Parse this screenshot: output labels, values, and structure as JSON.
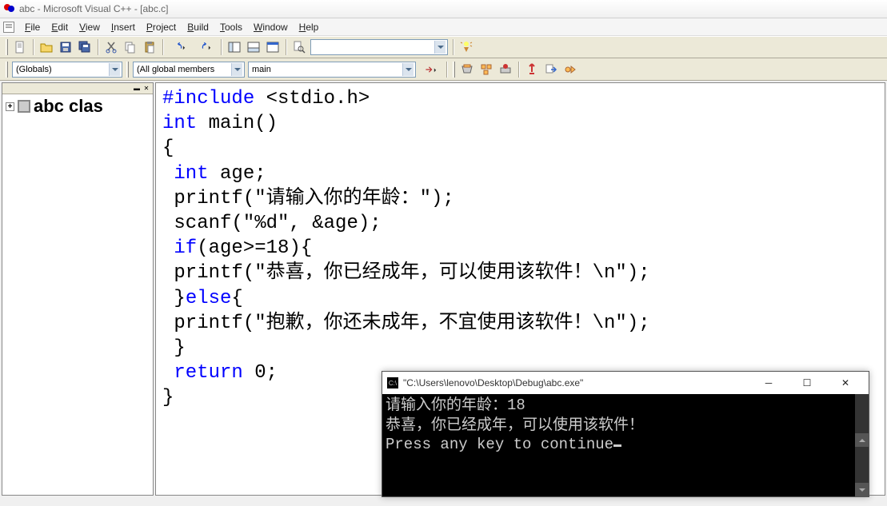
{
  "window": {
    "title": "abc - Microsoft Visual C++ - [abc.c]"
  },
  "menu": {
    "file": "File",
    "edit": "Edit",
    "view": "View",
    "insert": "Insert",
    "project": "Project",
    "build": "Build",
    "tools": "Tools",
    "window": "Window",
    "help": "Help"
  },
  "toolbar2": {
    "scope": "(Globals)",
    "members": "(All global members",
    "func": "main"
  },
  "tree": {
    "root": "abc clas"
  },
  "code": {
    "l1a": "#include",
    "l1b": " <stdio.h>",
    "l2a": "int",
    "l2b": " main()",
    "l3": "{",
    "l4a": " int",
    "l4b": " age;",
    "l5": " printf(\"请输入你的年龄：\");",
    "l6": " scanf(\"%d\", &age);",
    "l7a": " if",
    "l7b": "(age>=18){",
    "l8": " printf(\"恭喜，你已经成年，可以使用该软件！\\n\");",
    "l9a": " }",
    "l9b": "else",
    "l9c": "{",
    "l10": " printf(\"抱歉，你还未成年，不宜使用该软件！\\n\");",
    "l11": " }",
    "l12a": " return",
    "l12b": " 0;",
    "l13": "}"
  },
  "console": {
    "title": "\"C:\\Users\\lenovo\\Desktop\\Debug\\abc.exe\"",
    "line1": "请输入你的年龄：18",
    "line2": "恭喜，你已经成年，可以使用该软件！",
    "line3": "Press any key to continue"
  }
}
